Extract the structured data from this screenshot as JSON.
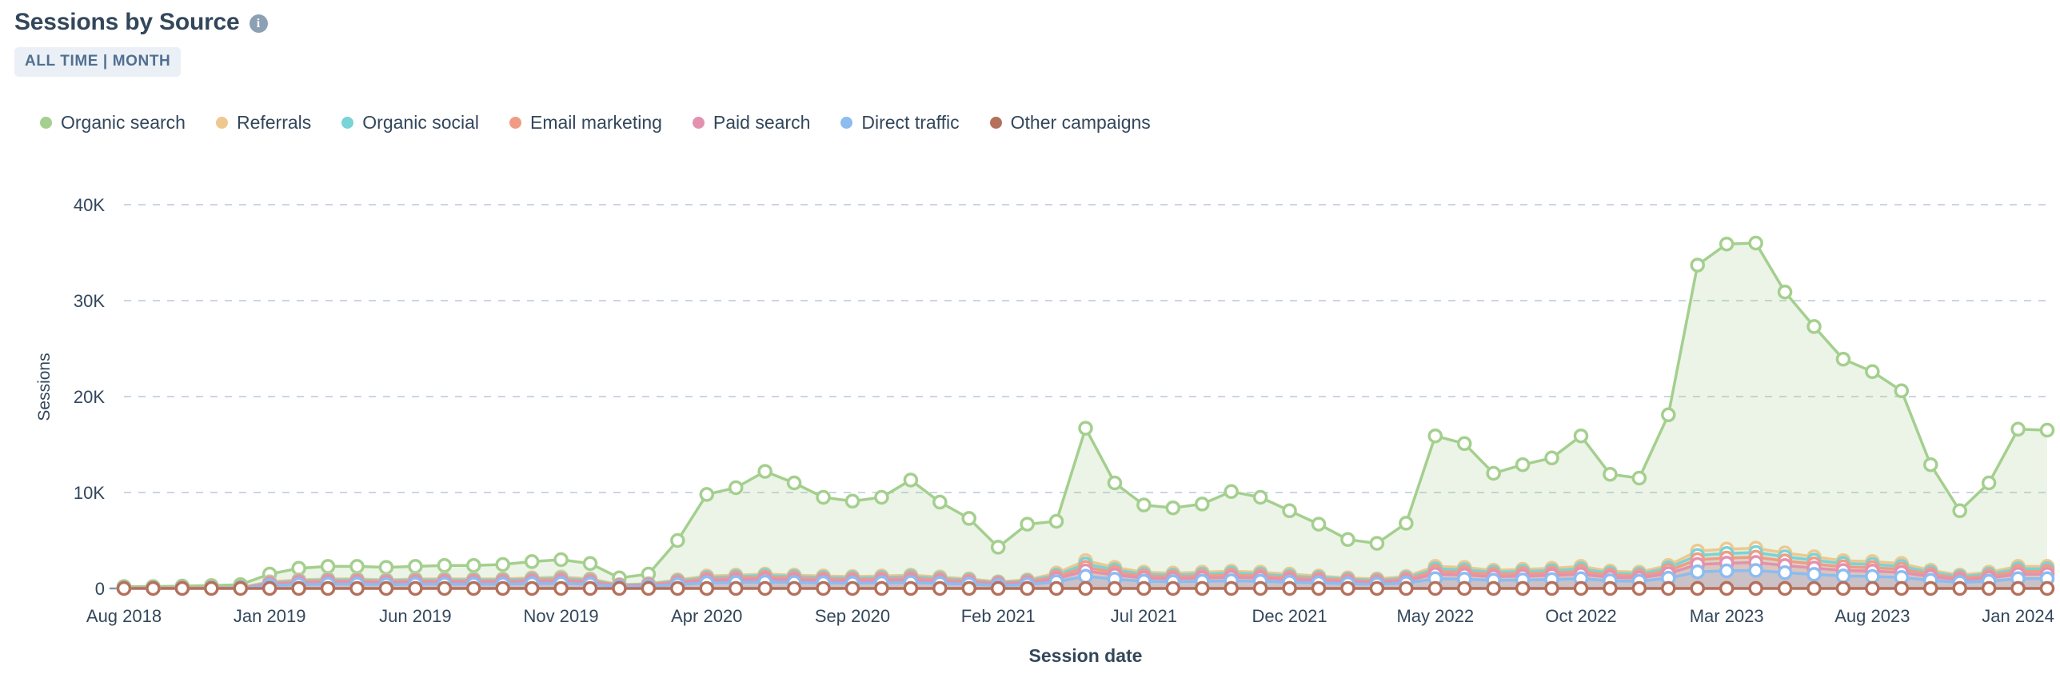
{
  "header": {
    "title": "Sessions by Source",
    "info_icon": "info-icon",
    "badge": "ALL TIME | MONTH"
  },
  "legend": {
    "items": [
      {
        "label": "Organic search",
        "color": "#a4cf8e"
      },
      {
        "label": "Referrals",
        "color": "#eec88f"
      },
      {
        "label": "Organic social",
        "color": "#7ad3d6"
      },
      {
        "label": "Email marketing",
        "color": "#f09c84"
      },
      {
        "label": "Paid search",
        "color": "#e292ae"
      },
      {
        "label": "Direct traffic",
        "color": "#8cbcf0"
      },
      {
        "label": "Other campaigns",
        "color": "#b5705c"
      }
    ]
  },
  "chart_data": {
    "type": "area",
    "title": "Sessions by Source",
    "xlabel": "Session date",
    "ylabel": "Sessions",
    "ylim": [
      0,
      42000
    ],
    "ytick_values": [
      0,
      10000,
      20000,
      30000,
      40000
    ],
    "ytick_labels": [
      "0",
      "10K",
      "20K",
      "30K",
      "40K"
    ],
    "grid": true,
    "legend_position": "top-left",
    "xtick_labels": [
      "Aug 2018",
      "Jan 2019",
      "Jun 2019",
      "Nov 2019",
      "Apr 2020",
      "Sep 2020",
      "Feb 2021",
      "Jul 2021",
      "Dec 2021",
      "May 2022",
      "Oct 2022",
      "Mar 2023",
      "Aug 2023",
      "Jan 2024"
    ],
    "xtick_indices": [
      0,
      5,
      10,
      15,
      20,
      25,
      30,
      35,
      40,
      45,
      50,
      55,
      60,
      65
    ],
    "x": [
      "Aug 2018",
      "Sep 2018",
      "Oct 2018",
      "Nov 2018",
      "Dec 2018",
      "Jan 2019",
      "Feb 2019",
      "Mar 2019",
      "Apr 2019",
      "May 2019",
      "Jun 2019",
      "Jul 2019",
      "Aug 2019",
      "Sep 2019",
      "Oct 2019",
      "Nov 2019",
      "Dec 2019",
      "Jan 2020",
      "Feb 2020",
      "Mar 2020",
      "Apr 2020",
      "May 2020",
      "Jun 2020",
      "Jul 2020",
      "Aug 2020",
      "Sep 2020",
      "Oct 2020",
      "Nov 2020",
      "Dec 2020",
      "Jan 2021",
      "Feb 2021",
      "Mar 2021",
      "Apr 2021",
      "May 2021",
      "Jun 2021",
      "Jul 2021",
      "Aug 2021",
      "Sep 2021",
      "Oct 2021",
      "Nov 2021",
      "Dec 2021",
      "Jan 2022",
      "Feb 2022",
      "Mar 2022",
      "Apr 2022",
      "May 2022",
      "Jun 2022",
      "Jul 2022",
      "Aug 2022",
      "Sep 2022",
      "Oct 2022",
      "Nov 2022",
      "Dec 2022",
      "Jan 2023",
      "Feb 2023",
      "Mar 2023",
      "Apr 2023",
      "May 2023",
      "Jun 2023",
      "Jul 2023",
      "Aug 2023",
      "Sep 2023",
      "Oct 2023",
      "Nov 2023",
      "Dec 2023",
      "Jan 2024",
      "Feb 2024"
    ],
    "series": [
      {
        "name": "Organic search",
        "color": "#a4cf8e",
        "values": [
          200,
          200,
          250,
          300,
          400,
          1500,
          2100,
          2300,
          2300,
          2200,
          2300,
          2400,
          2400,
          2500,
          2800,
          3000,
          2600,
          1100,
          1500,
          5000,
          9800,
          10500,
          12200,
          11000,
          9500,
          9100,
          9500,
          11300,
          9000,
          7300,
          4300,
          6700,
          7000,
          16700,
          11000,
          8700,
          8400,
          8800,
          10100,
          9500,
          8100,
          6700,
          5100,
          4700,
          6800,
          15900,
          15100,
          12000,
          12900,
          13600,
          15900,
          11900,
          11500,
          18100,
          33700,
          35900,
          36000,
          30900,
          27300,
          23900,
          22600,
          20600,
          12900,
          8100,
          11000,
          16600,
          16500
        ]
      },
      {
        "name": "Referrals",
        "color": "#eec88f",
        "values": [
          60,
          60,
          70,
          80,
          100,
          700,
          900,
          1000,
          1000,
          900,
          1000,
          1000,
          1000,
          1000,
          1100,
          1200,
          1000,
          400,
          500,
          900,
          1300,
          1400,
          1500,
          1400,
          1300,
          1250,
          1300,
          1400,
          1200,
          1000,
          700,
          900,
          1600,
          2900,
          2200,
          1700,
          1600,
          1700,
          1800,
          1700,
          1500,
          1300,
          1100,
          1000,
          1250,
          2300,
          2200,
          1900,
          2000,
          2100,
          2300,
          1800,
          1700,
          2400,
          3900,
          4100,
          4200,
          3700,
          3300,
          2900,
          2800,
          2600,
          1900,
          1400,
          1700,
          2300,
          2300
        ]
      },
      {
        "name": "Organic social",
        "color": "#7ad3d6",
        "values": [
          50,
          50,
          60,
          70,
          90,
          600,
          800,
          900,
          900,
          800,
          900,
          900,
          900,
          900,
          1000,
          1050,
          900,
          350,
          450,
          800,
          1150,
          1250,
          1350,
          1250,
          1150,
          1100,
          1150,
          1250,
          1050,
          900,
          620,
          800,
          1400,
          2550,
          1950,
          1500,
          1400,
          1500,
          1600,
          1500,
          1300,
          1150,
          980,
          880,
          1100,
          2050,
          1950,
          1700,
          1780,
          1870,
          2050,
          1600,
          1500,
          2150,
          3450,
          3650,
          3750,
          3300,
          2950,
          2600,
          2500,
          2300,
          1700,
          1250,
          1500,
          2050,
          2050
        ]
      },
      {
        "name": "Email marketing",
        "color": "#f09c84",
        "values": [
          40,
          40,
          50,
          60,
          75,
          520,
          700,
          780,
          780,
          700,
          780,
          780,
          780,
          780,
          860,
          900,
          780,
          300,
          390,
          690,
          1000,
          1080,
          1170,
          1080,
          1000,
          960,
          1000,
          1080,
          910,
          780,
          540,
          690,
          1220,
          2200,
          1690,
          1300,
          1220,
          1300,
          1390,
          1300,
          1130,
          1000,
          850,
          760,
          960,
          1780,
          1690,
          1480,
          1540,
          1620,
          1780,
          1390,
          1300,
          1870,
          3000,
          3170,
          3260,
          2870,
          2560,
          2260,
          2170,
          2000,
          1480,
          1080,
          1300,
          1780,
          1780
        ]
      },
      {
        "name": "Paid search",
        "color": "#e292ae",
        "values": [
          30,
          30,
          38,
          45,
          58,
          430,
          580,
          650,
          650,
          580,
          650,
          650,
          650,
          650,
          720,
          750,
          650,
          250,
          320,
          570,
          830,
          900,
          970,
          900,
          830,
          800,
          830,
          900,
          760,
          650,
          450,
          570,
          1010,
          1830,
          1400,
          1080,
          1010,
          1080,
          1160,
          1080,
          940,
          830,
          700,
          630,
          800,
          1480,
          1400,
          1230,
          1280,
          1350,
          1480,
          1160,
          1080,
          1550,
          2500,
          2640,
          2710,
          2390,
          2130,
          1880,
          1810,
          1670,
          1230,
          900,
          1080,
          1480,
          1480
        ]
      },
      {
        "name": "Direct traffic",
        "color": "#8cbcf0",
        "values": [
          20,
          20,
          25,
          30,
          40,
          300,
          400,
          450,
          450,
          400,
          450,
          450,
          450,
          450,
          500,
          520,
          450,
          170,
          220,
          400,
          580,
          620,
          670,
          620,
          580,
          550,
          580,
          620,
          520,
          450,
          310,
          400,
          700,
          1270,
          970,
          750,
          700,
          750,
          800,
          750,
          650,
          580,
          490,
          440,
          550,
          1020,
          970,
          850,
          890,
          930,
          1020,
          800,
          750,
          1070,
          1730,
          1830,
          1880,
          1650,
          1470,
          1300,
          1250,
          1150,
          850,
          620,
          750,
          1020,
          1020
        ]
      },
      {
        "name": "Other campaigns",
        "color": "#b5705c",
        "values": [
          0,
          0,
          0,
          0,
          0,
          0,
          0,
          0,
          0,
          0,
          0,
          0,
          0,
          0,
          0,
          0,
          0,
          0,
          0,
          0,
          0,
          0,
          0,
          0,
          0,
          0,
          0,
          0,
          0,
          0,
          0,
          0,
          0,
          0,
          0,
          0,
          0,
          0,
          0,
          0,
          0,
          0,
          0,
          0,
          0,
          0,
          0,
          0,
          0,
          0,
          0,
          0,
          0,
          0,
          0,
          0,
          0,
          0,
          0,
          0,
          0,
          0,
          0,
          0,
          0,
          0,
          0
        ]
      }
    ]
  }
}
